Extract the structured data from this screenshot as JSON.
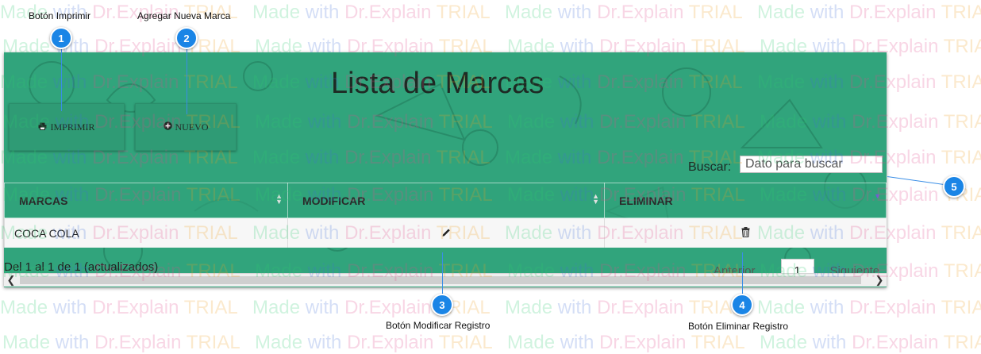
{
  "page": {
    "title": "Lista de Marcas",
    "print_button": "IMPRIMIR",
    "new_button": "NUEVO",
    "search_label": "Buscar:",
    "search_placeholder": "Dato para buscar"
  },
  "table": {
    "columns": [
      "MARCAS",
      "MODIFICAR",
      "ELIMINAR"
    ],
    "rows": [
      {
        "marca": "COCA COLA"
      }
    ]
  },
  "footer": {
    "info": "Del 1 al 1 de 1 (actualizados)",
    "prev": "Anterior",
    "page": "1",
    "next": "Siguiente"
  },
  "callouts": [
    {
      "num": "1",
      "label": "Botón Imprimir"
    },
    {
      "num": "2",
      "label": "Agregar Nueva Marca"
    },
    {
      "num": "3",
      "label": "Botón Modificar Registro"
    },
    {
      "num": "4",
      "label": "Botón Eliminar Registro"
    },
    {
      "num": "5",
      "label": ""
    }
  ],
  "watermark": {
    "made": "Made",
    "with": "with",
    "dr": "Dr.Explain",
    "trial": "TRIAL"
  },
  "colors": {
    "panel": "#31a47c",
    "callout": "#1a85e6"
  },
  "icons": {
    "print": "printer-icon",
    "new": "plus-circle-icon",
    "edit": "pencil-icon",
    "delete": "trash-icon"
  }
}
